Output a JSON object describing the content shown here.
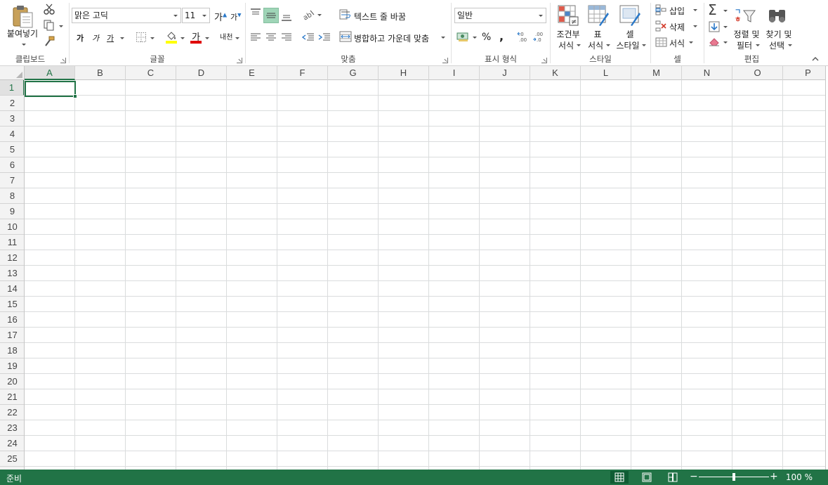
{
  "ribbon": {
    "clipboard": {
      "group_label": "클립보드",
      "paste_label": "붙여넣기"
    },
    "font": {
      "group_label": "글꼴",
      "font_name": "맑은 고딕",
      "font_size": "11",
      "grow_label": "가",
      "shrink_label": "가",
      "bold_label": "가",
      "italic_label": "가",
      "underline_label": "가",
      "font_color_label": "가",
      "phonetic_label": "내천"
    },
    "alignment": {
      "group_label": "맞춤",
      "wrap_text_label": "텍스트 줄 바꿈",
      "merge_center_label": "병합하고 가운데 맞춤"
    },
    "number": {
      "group_label": "표시 형식",
      "format_value": "일반",
      "percent_label": "%",
      "comma_label": ","
    },
    "styles": {
      "group_label": "스타일",
      "conditional_label_1": "조건부",
      "conditional_label_2": "서식",
      "table_label_1": "표",
      "table_label_2": "서식",
      "cell_style_label_1": "셀",
      "cell_style_label_2": "스타일"
    },
    "cells": {
      "group_label": "셀",
      "insert_label": "삽입",
      "delete_label": "삭제",
      "format_label": "서식"
    },
    "editing": {
      "group_label": "편집",
      "sort_label_1": "정렬 및",
      "sort_label_2": "필터",
      "find_label_1": "찾기 및",
      "find_label_2": "선택"
    }
  },
  "sheet": {
    "columns": [
      "A",
      "B",
      "C",
      "D",
      "E",
      "F",
      "G",
      "H",
      "I",
      "J",
      "K",
      "L",
      "M",
      "N",
      "O",
      "P"
    ],
    "rows": [
      "1",
      "2",
      "3",
      "4",
      "5",
      "6",
      "7",
      "8",
      "9",
      "10",
      "11",
      "12",
      "13",
      "14",
      "15",
      "16",
      "17",
      "18",
      "19",
      "20",
      "21",
      "22",
      "23",
      "24",
      "25"
    ],
    "selected_column": "A",
    "selected_row": "1"
  },
  "status": {
    "text": "준비",
    "zoom": "100 %",
    "zoom_level": 0.5
  },
  "colors": {
    "accent": "#217346",
    "grid": "#dadcdd"
  }
}
